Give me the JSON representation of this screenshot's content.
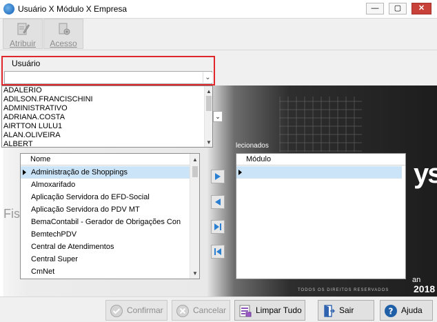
{
  "window": {
    "title": "Usuário X Módulo X Empresa",
    "controls": {
      "minimize": "—",
      "maximize": "▢",
      "close": "✕"
    }
  },
  "toolbar": {
    "atribuir": "Atribuir",
    "acesso": "Acesso"
  },
  "usuario": {
    "label": "Usuário",
    "value": "",
    "dropdown_arrow": "⌄",
    "options": [
      "ADALERIO",
      "ADILSON.FRANCISCHINI",
      "ADMINISTRATIVO",
      "ADRIANA.COSTA",
      "AIRTTON LULU1",
      "ALAN.OLIVEIRA",
      "ALBERT"
    ]
  },
  "modulos_disponiveis": {
    "header": "Nome",
    "rows": [
      "Administração de Shoppings",
      "Almoxarifado",
      "Aplicação Servidora do EFD-Social",
      "Aplicação Servidora do PDV MT",
      "BemaContabil - Gerador de Obrigações Con",
      "BemtechPDV",
      "Central de Atendimentos",
      "Central Super",
      "CmNet"
    ],
    "selected_index": 0
  },
  "modulos_selecionados": {
    "caption": "lecionados",
    "header": "Módulo",
    "rows": []
  },
  "background": {
    "fis": "Fis",
    "ys": "ys",
    "dan": "an",
    "year": "2018",
    "rights": "TODOS OS DIREITOS RESERVADOS"
  },
  "buttons": {
    "confirmar": {
      "label": "Confirmar",
      "enabled": false
    },
    "cancelar": {
      "label": "Cancelar",
      "enabled": false
    },
    "limpar_tudo": {
      "label": "Limpar Tudo",
      "enabled": true
    },
    "sair": {
      "label": "Sair",
      "enabled": true
    },
    "ajuda": {
      "label": "Ajuda",
      "enabled": true
    }
  },
  "colors": {
    "focus_border": "#e0262a",
    "selection": "#cce4f7",
    "transfer_arrow": "#2b7fd1",
    "help_icon": "#1f5fa8"
  }
}
